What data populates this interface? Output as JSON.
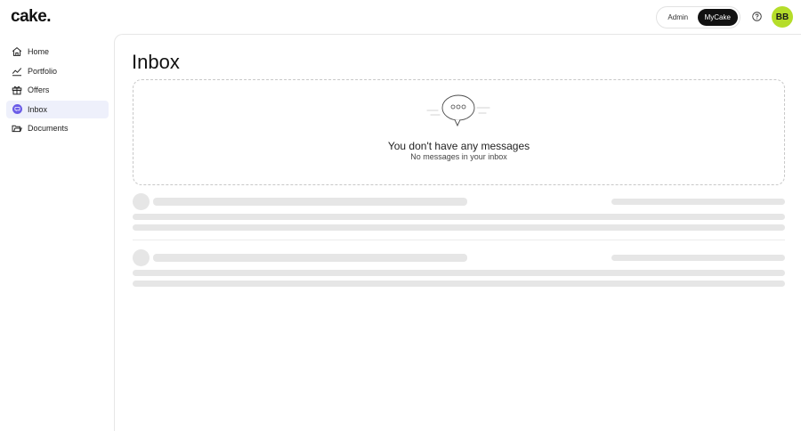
{
  "brand": {
    "logo_text": "cake."
  },
  "header": {
    "toggle": {
      "admin_label": "Admin",
      "mycake_label": "MyCake",
      "selected": "MyCake"
    },
    "help_icon": "question-circle-icon",
    "avatar_initials": "BB",
    "avatar_color": "#b5dd2a"
  },
  "sidebar": {
    "items": [
      {
        "label": "Home",
        "icon": "home-icon",
        "active": false
      },
      {
        "label": "Portfolio",
        "icon": "chart-line-icon",
        "active": false
      },
      {
        "label": "Offers",
        "icon": "gift-icon",
        "active": false
      },
      {
        "label": "Inbox",
        "icon": "chat-bubble-icon",
        "active": true
      },
      {
        "label": "Documents",
        "icon": "folders-icon",
        "active": false
      }
    ]
  },
  "main": {
    "title": "Inbox",
    "empty_state": {
      "icon": "speech-bubble-icon",
      "title": "You don't have any messages",
      "subtitle": "No messages in your inbox"
    }
  },
  "colors": {
    "accent": "#6b5ce7",
    "active_bg": "#eef0fb",
    "skeleton": "#e6e6e6",
    "toggle_selected": "#111111"
  }
}
